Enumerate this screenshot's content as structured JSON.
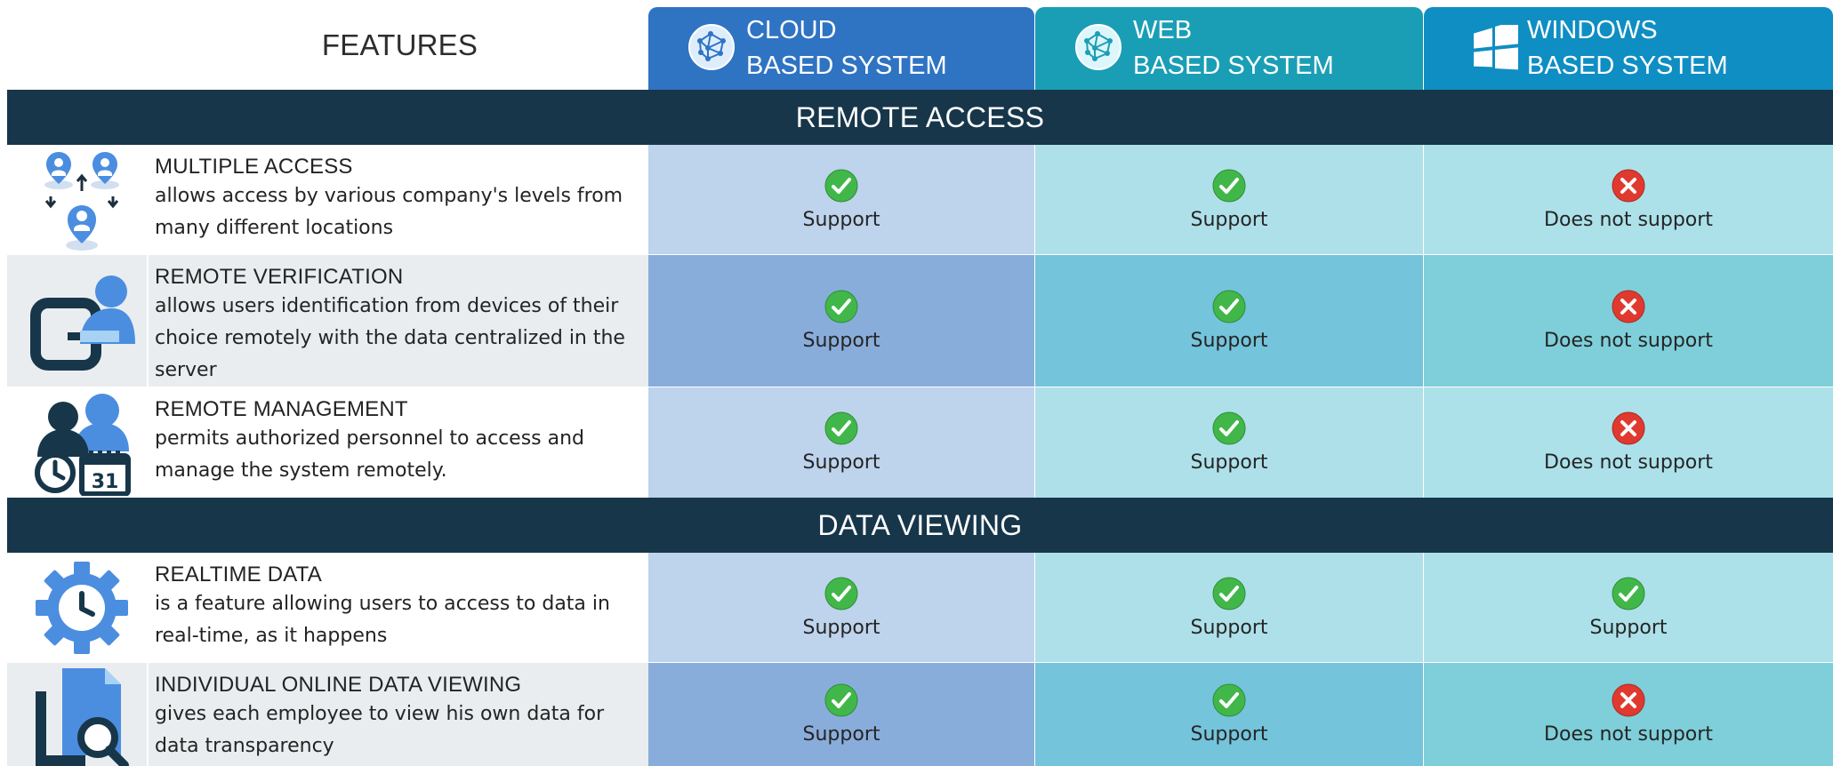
{
  "header": {
    "features_label": "FEATURES",
    "columns": [
      {
        "key": "cloud",
        "line1": "CLOUD",
        "line2": "BASED SYSTEM",
        "icon": "globe-network-icon",
        "color": "#2f73c3"
      },
      {
        "key": "web",
        "line1": "WEB",
        "line2": "BASED SYSTEM",
        "icon": "globe-network-icon",
        "color": "#1a9eb5"
      },
      {
        "key": "windows",
        "line1": "WINDOWS",
        "line2": "BASED SYSTEM",
        "icon": "windows-logo-icon",
        "color": "#0f8ec3"
      }
    ]
  },
  "sections": [
    {
      "title": "REMOTE ACCESS",
      "rows": [
        {
          "title": "MULTIPLE ACCESS",
          "desc_lines": [
            "allows access by various company's levels from",
            "many different locations"
          ],
          "icon": "multiple-access-icon",
          "status": {
            "cloud": "Support",
            "web": "Support",
            "windows": "Does not support"
          }
        },
        {
          "title": "REMOTE VERIFICATION",
          "desc_lines": [
            "allows users identification from devices of their",
            "choice remotely with the data centralized in the",
            "server"
          ],
          "icon": "remote-verification-icon",
          "status": {
            "cloud": "Support",
            "web": "Support",
            "windows": "Does not support"
          }
        },
        {
          "title": "REMOTE MANAGEMENT",
          "desc_lines": [
            "permits authorized personnel to access and",
            "manage the system remotely."
          ],
          "icon": "remote-management-icon",
          "calendar_number": "31",
          "status": {
            "cloud": "Support",
            "web": "Support",
            "windows": "Does not support"
          }
        }
      ]
    },
    {
      "title": "DATA VIEWING",
      "rows": [
        {
          "title": "REALTIME DATA",
          "desc_lines": [
            "is a feature allowing users to access to data in",
            "real-time, as it happens"
          ],
          "icon": "realtime-data-icon",
          "status": {
            "cloud": "Support",
            "web": "Support",
            "windows": "Support"
          }
        },
        {
          "title": "INDIVIDUAL ONLINE DATA VIEWING",
          "desc_lines": [
            "gives each employee to view his own data for",
            "data transparency"
          ],
          "icon": "document-search-icon",
          "status": {
            "cloud": "Support",
            "web": "Support",
            "windows": "Does not support"
          }
        }
      ]
    }
  ],
  "colors": {
    "section_bar": "#17364a",
    "support_green": "#41b749",
    "not_support_red": "#e0392f"
  }
}
